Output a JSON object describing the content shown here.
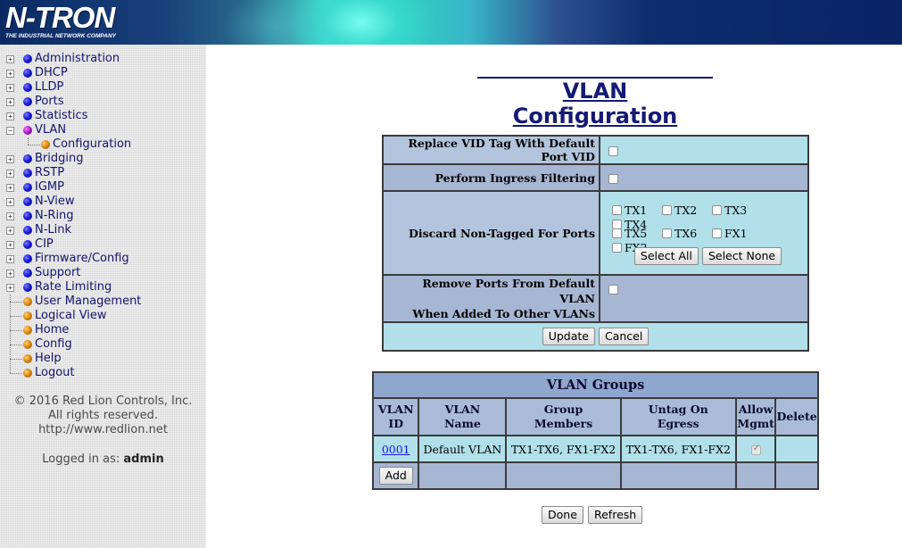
{
  "header": {
    "logo_text": "N-TRON",
    "logo_tagline": "THE INDUSTRIAL NETWORK COMPANY"
  },
  "sidebar": {
    "items": [
      {
        "label": "Administration",
        "dot": "blue",
        "expander": "+"
      },
      {
        "label": "DHCP",
        "dot": "blue",
        "expander": "+"
      },
      {
        "label": "LLDP",
        "dot": "blue",
        "expander": "+"
      },
      {
        "label": "Ports",
        "dot": "blue",
        "expander": "+"
      },
      {
        "label": "Statistics",
        "dot": "blue",
        "expander": "+"
      },
      {
        "label": "VLAN",
        "dot": "purple",
        "expander": "-"
      },
      {
        "label": "Configuration",
        "dot": "orange",
        "child": true
      },
      {
        "label": "Bridging",
        "dot": "blue",
        "expander": "+"
      },
      {
        "label": "RSTP",
        "dot": "blue",
        "expander": "+"
      },
      {
        "label": "IGMP",
        "dot": "blue",
        "expander": "+"
      },
      {
        "label": "N-View",
        "dot": "blue",
        "expander": "+"
      },
      {
        "label": "N-Ring",
        "dot": "blue",
        "expander": "+"
      },
      {
        "label": "N-Link",
        "dot": "blue",
        "expander": "+"
      },
      {
        "label": "CIP",
        "dot": "blue",
        "expander": "+"
      },
      {
        "label": "Firmware/Config",
        "dot": "blue",
        "expander": "+"
      },
      {
        "label": "Support",
        "dot": "blue",
        "expander": "+"
      },
      {
        "label": "Rate Limiting",
        "dot": "blue",
        "expander": "+"
      },
      {
        "label": "User Management",
        "dot": "orange"
      },
      {
        "label": "Logical View",
        "dot": "orange"
      },
      {
        "label": "Home",
        "dot": "orange"
      },
      {
        "label": "Config",
        "dot": "orange"
      },
      {
        "label": "Help",
        "dot": "orange"
      },
      {
        "label": "Logout",
        "dot": "orange"
      }
    ],
    "copyright": "© 2016 Red Lion Controls, Inc.",
    "rights": "All rights reserved.",
    "url": "http://www.redlion.net",
    "logged_in_prefix": "Logged in as:",
    "logged_in_user": "admin"
  },
  "main": {
    "title": "VLAN Configuration",
    "config": {
      "replace_vid_label": "Replace VID Tag With Default Port VID",
      "ingress_label": "Perform Ingress Filtering",
      "discard_label": "Discard Non-Tagged For Ports",
      "ports_row1": [
        "TX1",
        "TX2",
        "TX3",
        "TX4"
      ],
      "ports_row2": [
        "TX5",
        "TX6",
        "FX1",
        "FX2"
      ],
      "select_all": "Select All",
      "select_none": "Select None",
      "remove_label_line1": "Remove Ports From Default VLAN",
      "remove_label_line2": "When Added To Other VLANs",
      "update": "Update",
      "cancel": "Cancel"
    },
    "groups": {
      "title": "VLAN Groups",
      "col_vlan_id": [
        "VLAN",
        "ID"
      ],
      "col_vlan_name": [
        "VLAN",
        "Name"
      ],
      "col_group_members": [
        "Group",
        "Members"
      ],
      "col_untag": [
        "Untag On",
        "Egress"
      ],
      "col_allow_mgmt": [
        "Allow",
        "Mgmt"
      ],
      "col_delete": "Delete",
      "rows": [
        {
          "id": "0001",
          "name": "Default VLAN",
          "members": "TX1-TX6, FX1-FX2",
          "untag": "TX1-TX6, FX1-FX2",
          "allow_mgmt": true
        }
      ],
      "add": "Add"
    },
    "done": "Done",
    "refresh": "Refresh"
  }
}
